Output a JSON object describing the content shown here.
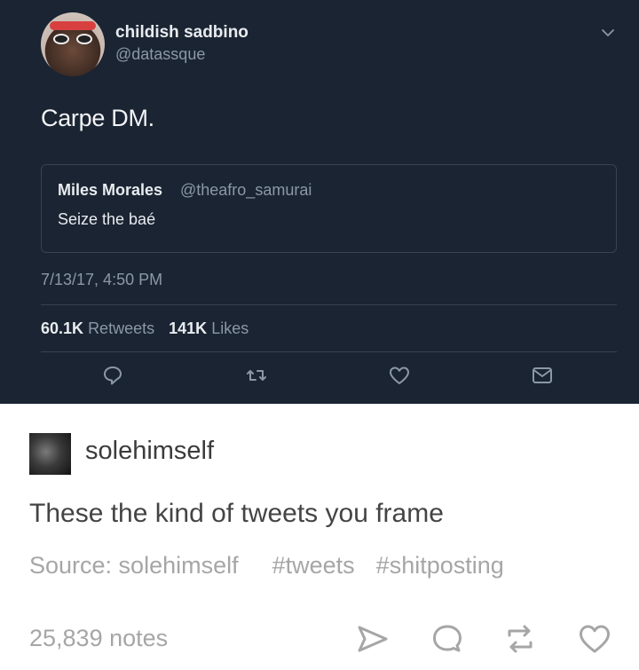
{
  "tweet": {
    "display_name": "childish sadbino",
    "handle": "@datassque",
    "text": "Carpe DM.",
    "quoted": {
      "display_name": "Miles Morales",
      "handle": "@theafro_samurai",
      "text": "Seize the baé"
    },
    "timestamp": "7/13/17, 4:50 PM",
    "retweets_count": "60.1K",
    "retweets_label": "Retweets",
    "likes_count": "141K",
    "likes_label": "Likes",
    "icons": [
      "chevron-down-icon",
      "reply-icon",
      "retweet-icon",
      "like-icon",
      "direct-message-icon"
    ],
    "colors": {
      "background": "#1b2432",
      "muted": "#8a98a8",
      "text": "#e8ecf0"
    }
  },
  "post": {
    "username": "solehimself",
    "text": "These the kind of tweets you frame",
    "source_label": "Source: solehimself",
    "tags": [
      "#tweets",
      "#shitposting"
    ],
    "notes": "25,839 notes",
    "icons": [
      "share-icon",
      "reply-icon",
      "reblog-icon",
      "like-icon"
    ],
    "colors": {
      "muted": "#a6a6a6",
      "text": "#444444"
    }
  }
}
